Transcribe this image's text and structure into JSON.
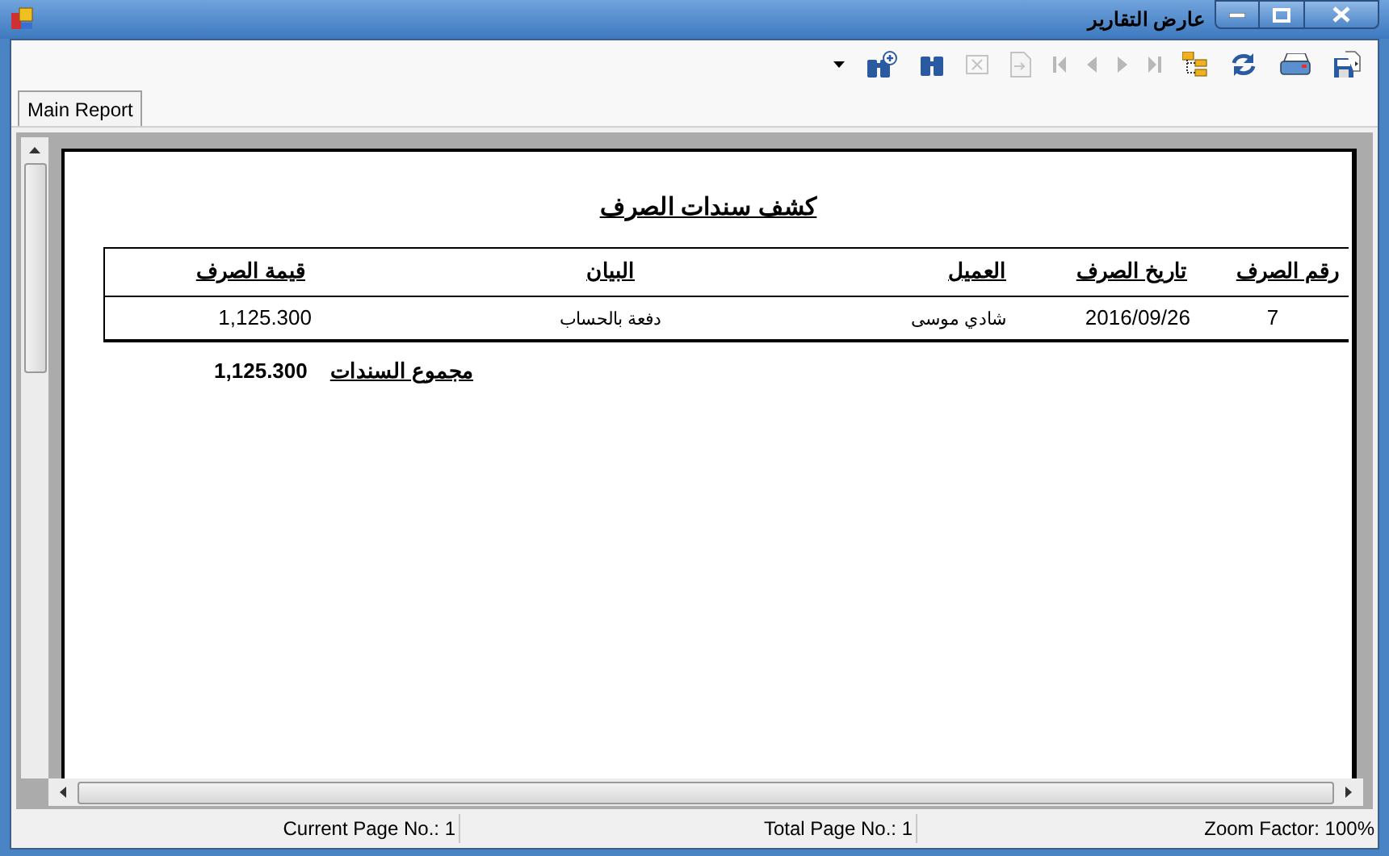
{
  "window": {
    "title": "عارض التقارير"
  },
  "toolbar": [
    {
      "kind": "dropdown",
      "disabled": false
    },
    {
      "kind": "zoom",
      "disabled": false
    },
    {
      "kind": "find",
      "disabled": false
    },
    {
      "kind": "close",
      "disabled": true
    },
    {
      "kind": "export",
      "disabled": true
    },
    {
      "kind": "first",
      "disabled": true
    },
    {
      "kind": "prev",
      "disabled": true
    },
    {
      "kind": "next",
      "disabled": true
    },
    {
      "kind": "last",
      "disabled": true
    },
    {
      "kind": "tree",
      "disabled": false
    },
    {
      "kind": "refresh",
      "disabled": false
    },
    {
      "kind": "print",
      "disabled": false
    },
    {
      "kind": "save",
      "disabled": false
    }
  ],
  "tabs": [
    {
      "label": "Main Report",
      "selected": true
    }
  ],
  "report": {
    "title": "كشف سندات الصرف",
    "columns": [
      "رقم الصرف",
      "تاريخ الصرف",
      "العميل",
      "البيان",
      "قيمة الصرف"
    ],
    "rows": [
      [
        "7",
        "2016/09/26",
        "شادي موسى",
        "دفعة بالحساب",
        "1,125.300"
      ]
    ],
    "total_label": "مجموع السندات",
    "total_value": "1,125.300"
  },
  "status_bar": {
    "current_page": "Current Page No.: 1",
    "total_pages": "Total Page No.: 1",
    "zoom_factor": "Zoom Factor: 100%"
  }
}
